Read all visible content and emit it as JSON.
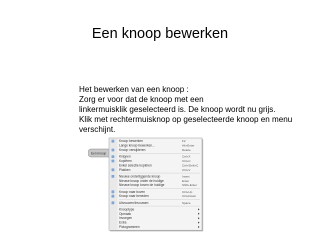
{
  "slide": {
    "title": "Een knoop bewerken",
    "body_lines": [
      "Het bewerken van een knoop :",
      " Zorg er voor dat de knoop met een",
      "linkermuisklik geselecteerd is. De knoop wordt nu grijs.",
      " Klik met rechtermuisknop op geselecteerde knoop en menu",
      "verschijnt."
    ]
  },
  "screenshot": {
    "node_label": "Een knoop",
    "accent_color": "#7fa7d6",
    "menu_bg": "#f4f4f4",
    "menu_items": [
      {
        "label": "Knoop bewerken",
        "shortcut": "F2",
        "icon": "edit-icon"
      },
      {
        "label": "Lange knoop bewerken...",
        "shortcut": "Alt+Enter",
        "icon": ""
      },
      {
        "label": "Knoop verwijderen",
        "shortcut": "Delete",
        "icon": "delete-icon"
      },
      {
        "separator": true
      },
      {
        "label": "Knippen",
        "shortcut": "Ctrl+X",
        "icon": "cut-icon"
      },
      {
        "label": "Kopiëren",
        "shortcut": "Ctrl+C",
        "icon": "copy-icon"
      },
      {
        "label": "Enkel selectie kopiëren",
        "shortcut": "Ctrl+Shift+C",
        "icon": ""
      },
      {
        "label": "Plakken",
        "shortcut": "Ctrl+V",
        "icon": "paste-icon"
      },
      {
        "separator": true
      },
      {
        "label": "Nieuwe onderliggende knoop",
        "shortcut": "Insert",
        "icon": "new-child-icon"
      },
      {
        "label": "Nieuwe knoop onder de huidige",
        "shortcut": "Enter",
        "icon": ""
      },
      {
        "label": "Nieuwe knoop boven de huidige",
        "shortcut": "Shift+Enter",
        "icon": ""
      },
      {
        "separator": true
      },
      {
        "label": "Knoop naar boven",
        "shortcut": "Ctrl+Up",
        "icon": "up-icon"
      },
      {
        "label": "Knoop naar beneden",
        "shortcut": "Ctrl+Down",
        "icon": "down-icon"
      },
      {
        "separator": true
      },
      {
        "label": "Uitvouwen/Invouwen",
        "shortcut": "Space",
        "icon": "fold-icon"
      },
      {
        "separator": true
      },
      {
        "label": "Knooptype",
        "shortcut": "",
        "submenu": true
      },
      {
        "label": "Opmaak",
        "shortcut": "",
        "submenu": true
      },
      {
        "label": "Invoegen",
        "shortcut": "",
        "submenu": true
      },
      {
        "label": "Extra",
        "shortcut": "",
        "submenu": true
      },
      {
        "label": "Pictogrammen",
        "shortcut": "",
        "submenu": true
      }
    ]
  }
}
